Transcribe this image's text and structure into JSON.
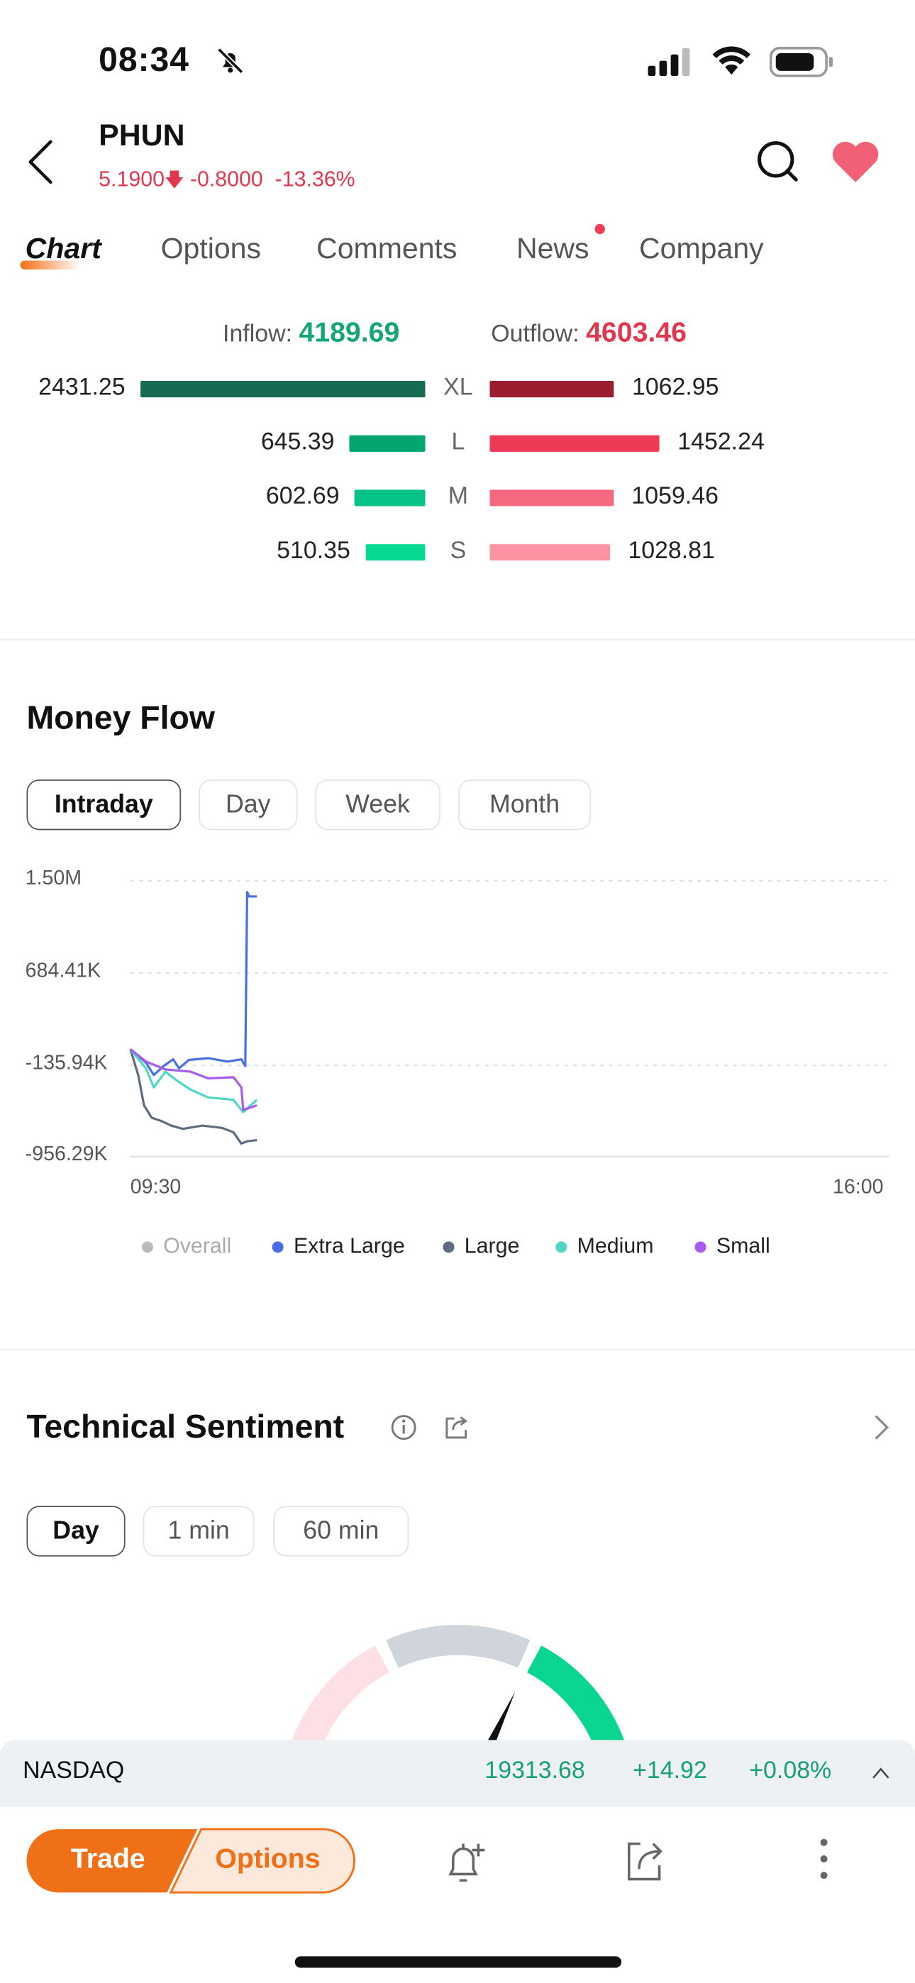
{
  "status_bar": {
    "time": "08:34",
    "icons": [
      "bell-slash-icon",
      "signal-icon",
      "wifi-icon",
      "battery-icon"
    ]
  },
  "header": {
    "ticker": "PHUN",
    "price": "5.1900",
    "direction": "down",
    "change": "-0.8000",
    "change_pct": "-13.36%"
  },
  "tabs": [
    {
      "label": "Chart",
      "active": true
    },
    {
      "label": "Options"
    },
    {
      "label": "Comments"
    },
    {
      "label": "News",
      "badge_dot": true
    },
    {
      "label": "Company"
    }
  ],
  "capital_flow": {
    "inflow_label": "Inflow:",
    "inflow_value": "4189.69",
    "outflow_label": "Outflow:",
    "outflow_value": "4603.46",
    "rows": [
      {
        "size": "XL",
        "inflow": "2431.25",
        "outflow": "1062.95",
        "in_color": "#176b52",
        "out_color": "#9b1c2e"
      },
      {
        "size": "L",
        "inflow": "645.39",
        "outflow": "1452.24",
        "in_color": "#05a571",
        "out_color": "#ee3a55"
      },
      {
        "size": "M",
        "inflow": "602.69",
        "outflow": "1059.46",
        "in_color": "#05c286",
        "out_color": "#f5687f"
      },
      {
        "size": "S",
        "inflow": "510.35",
        "outflow": "1028.81",
        "in_color": "#08d993",
        "out_color": "#fb93a3"
      }
    ]
  },
  "money_flow": {
    "title": "Money Flow",
    "periods": [
      {
        "label": "Intraday",
        "selected": true
      },
      {
        "label": "Day"
      },
      {
        "label": "Week"
      },
      {
        "label": "Month"
      }
    ]
  },
  "chart_data": {
    "type": "line",
    "y_ticks": [
      "1.50M",
      "684.41K",
      "-135.94K",
      "-956.29K"
    ],
    "x_ticks": [
      "09:30",
      "16:00"
    ],
    "xlim": [
      "09:30",
      "16:00"
    ],
    "ylim_k": [
      -956.29,
      1500
    ],
    "y_unit": "K",
    "grid": "horizontal dashed",
    "legend_position": "bottom",
    "series": [
      {
        "name": "Overall",
        "color": "#b5b5b5",
        "disabled": true,
        "points": []
      },
      {
        "name": "Extra Large",
        "color": "#4a6fe3",
        "points": [
          [
            "09:30",
            0
          ],
          [
            "09:38",
            -120
          ],
          [
            "09:42",
            -230
          ],
          [
            "09:44",
            -200
          ],
          [
            "09:47",
            -150
          ],
          [
            "09:52",
            -90
          ],
          [
            "09:55",
            -170
          ],
          [
            "10:00",
            -95
          ],
          [
            "10:10",
            -80
          ],
          [
            "10:20",
            -110
          ],
          [
            "10:27",
            -90
          ],
          [
            "10:29",
            -150
          ],
          [
            "10:30",
            1400
          ],
          [
            "10:31",
            1360
          ],
          [
            "10:35",
            1360
          ]
        ]
      },
      {
        "name": "Large",
        "color": "#5f6b7e",
        "points": [
          [
            "09:30",
            0
          ],
          [
            "09:34",
            -230
          ],
          [
            "09:37",
            -500
          ],
          [
            "09:41",
            -610
          ],
          [
            "09:46",
            -640
          ],
          [
            "09:51",
            -680
          ],
          [
            "09:57",
            -710
          ],
          [
            "10:07",
            -680
          ],
          [
            "10:17",
            -700
          ],
          [
            "10:23",
            -740
          ],
          [
            "10:27",
            -840
          ],
          [
            "10:30",
            -820
          ],
          [
            "10:35",
            -810
          ]
        ]
      },
      {
        "name": "Medium",
        "color": "#4fd6c4",
        "points": [
          [
            "09:30",
            0
          ],
          [
            "09:38",
            -170
          ],
          [
            "09:42",
            -340
          ],
          [
            "09:48",
            -200
          ],
          [
            "09:54",
            -280
          ],
          [
            "10:01",
            -360
          ],
          [
            "10:10",
            -430
          ],
          [
            "10:23",
            -450
          ],
          [
            "10:27",
            -540
          ],
          [
            "10:28",
            -560
          ],
          [
            "10:35",
            -450
          ]
        ]
      },
      {
        "name": "Small",
        "color": "#a65cf0",
        "points": [
          [
            "09:30",
            0
          ],
          [
            "09:38",
            -110
          ],
          [
            "09:48",
            -180
          ],
          [
            "10:01",
            -200
          ],
          [
            "10:10",
            -260
          ],
          [
            "10:23",
            -250
          ],
          [
            "10:27",
            -340
          ],
          [
            "10:28",
            -540
          ],
          [
            "10:35",
            -500
          ]
        ]
      }
    ]
  },
  "technical_sentiment": {
    "title": "Technical Sentiment",
    "periods": [
      {
        "label": "Day",
        "selected": true
      },
      {
        "label": "1 min"
      },
      {
        "label": "60 min"
      }
    ],
    "gauge_colors": [
      "#fde0e5",
      "#cfd5db",
      "#0bd68f"
    ]
  },
  "index_bar": {
    "name": "NASDAQ",
    "value": "19313.68",
    "change": "+14.92",
    "change_pct": "+0.08%"
  },
  "bottom_bar": {
    "trade_label": "Trade",
    "options_label": "Options",
    "accent": "#f07017"
  }
}
